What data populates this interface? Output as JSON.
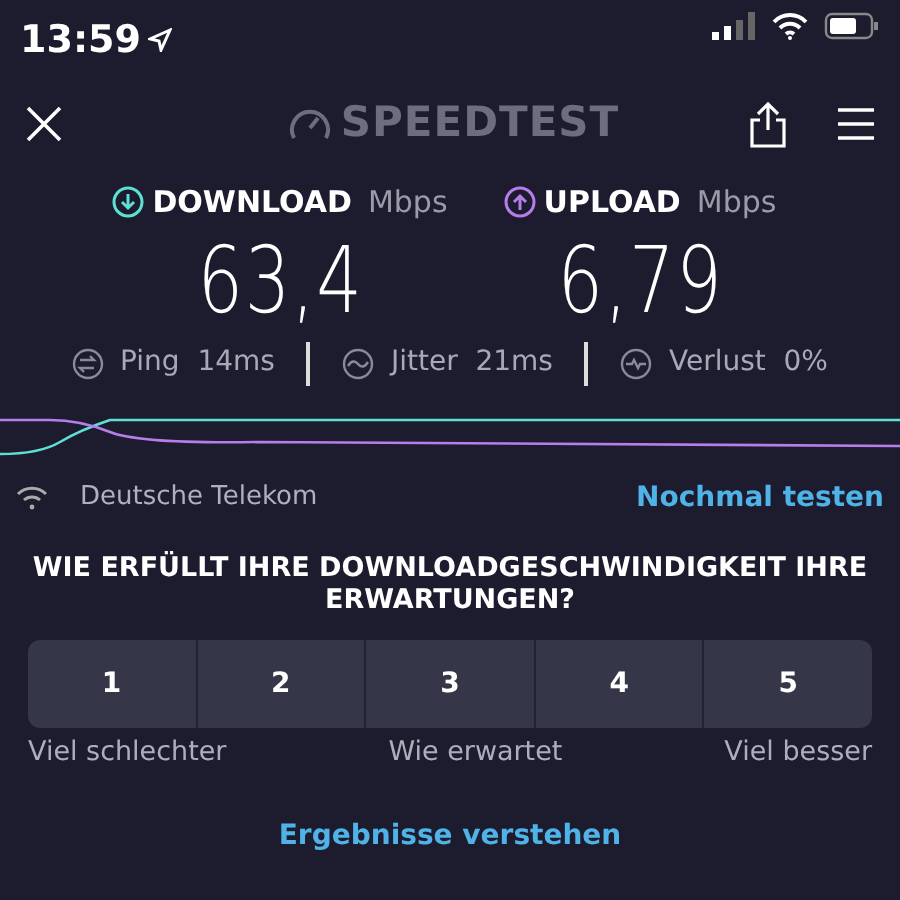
{
  "status_bar": {
    "time": "13:59"
  },
  "header": {
    "logo_text": "SPEEDTEST"
  },
  "results": [
    {
      "kind": "download",
      "label": "DOWNLOAD",
      "unit": "Mbps",
      "value": "63,4",
      "color": "#5ee0d4"
    },
    {
      "kind": "upload",
      "label": "UPLOAD",
      "unit": "Mbps",
      "value": "6,79",
      "color": "#b77de8"
    }
  ],
  "stats": [
    {
      "kind": "ping",
      "label": "Ping",
      "value": "14ms"
    },
    {
      "kind": "jitter",
      "label": "Jitter",
      "value": "21ms"
    },
    {
      "kind": "loss",
      "label": "Verlust",
      "value": "0%"
    }
  ],
  "provider": "Deutsche Telekom",
  "retest_link": "Nochmal testen",
  "survey": {
    "question": "WIE ERFÜLLT IHRE DOWNLOADGESCHWINDIGKEIT IHRE ERWARTUNGEN?",
    "options": [
      {
        "label": "1",
        "selected": false
      },
      {
        "label": "2",
        "selected": false
      },
      {
        "label": "3",
        "selected": false
      },
      {
        "label": "4",
        "selected": false
      },
      {
        "label": "5",
        "selected": false
      }
    ],
    "scale_labels": [
      "Viel schlechter",
      "Wie erwartet",
      "Viel besser"
    ]
  },
  "results_link": "Ergebnisse verstehen"
}
